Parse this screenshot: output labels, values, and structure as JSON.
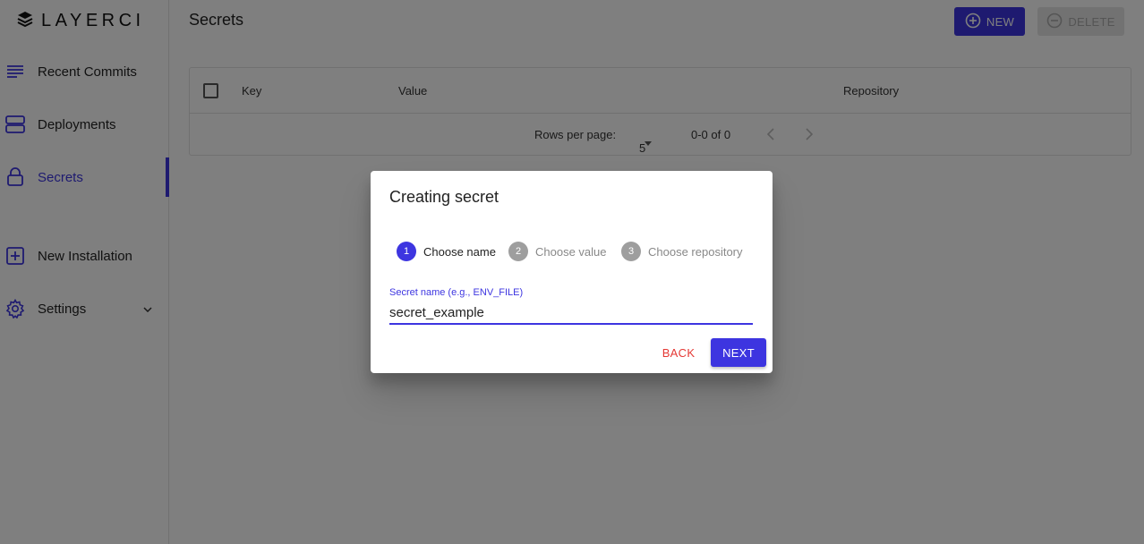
{
  "brand": {
    "name": "LAYERCI",
    "icon": "layers-icon"
  },
  "sidebar": {
    "items": [
      {
        "label": "Recent Commits",
        "icon": "list-icon"
      },
      {
        "label": "Deployments",
        "icon": "server-icon"
      },
      {
        "label": "Secrets",
        "icon": "lock-icon",
        "active": true
      },
      {
        "label": "New Installation",
        "icon": "plus-square-icon"
      },
      {
        "label": "Settings",
        "icon": "gear-icon",
        "expand_icon": "chevron-down-icon"
      }
    ]
  },
  "header": {
    "title": "Secrets",
    "new_label": "NEW",
    "delete_label": "DELETE"
  },
  "table": {
    "columns": [
      "Key",
      "Value",
      "Repository"
    ],
    "rows": [],
    "pagination": {
      "rows_per_page_label": "Rows per page:",
      "rows_per_page": "5",
      "range": "0-0 of 0"
    }
  },
  "dialog": {
    "title": "Creating secret",
    "steps": [
      {
        "number": "1",
        "label": "Choose name",
        "active": true
      },
      {
        "number": "2",
        "label": "Choose value",
        "active": false
      },
      {
        "number": "3",
        "label": "Choose repository",
        "active": false
      }
    ],
    "field": {
      "label": "Secret name (e.g., ENV_FILE)",
      "value": "secret_example"
    },
    "back_label": "BACK",
    "next_label": "NEXT"
  },
  "colors": {
    "accent": "#3d35e0",
    "danger": "#e53935",
    "disabled": "#e4e4e4"
  }
}
